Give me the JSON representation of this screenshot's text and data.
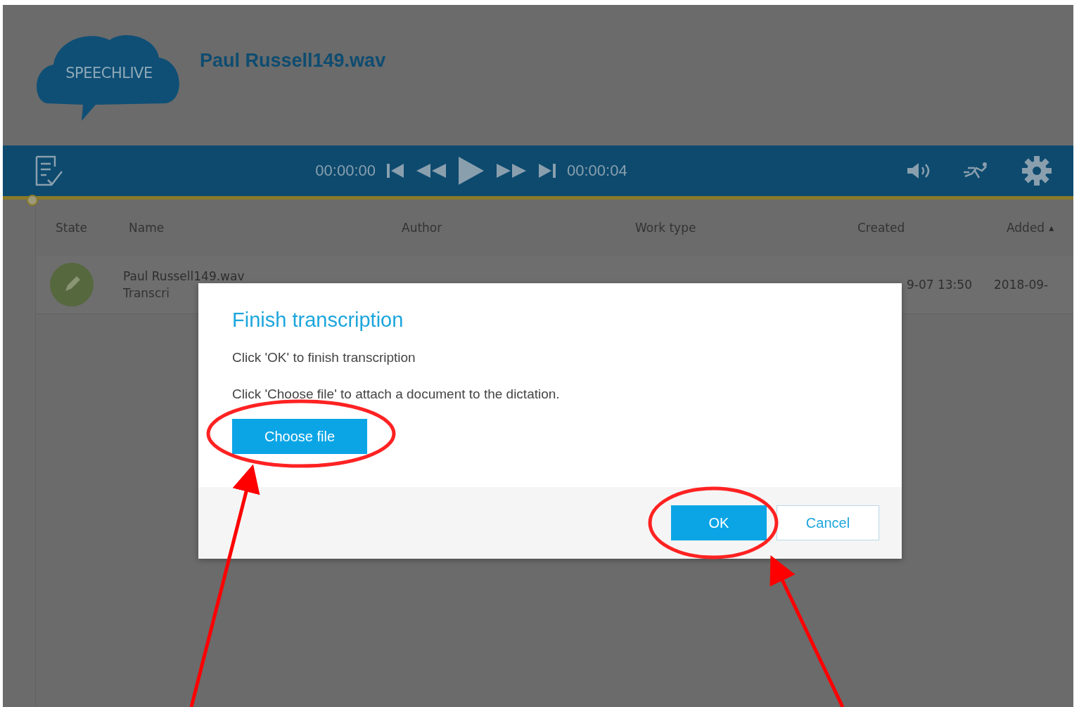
{
  "header": {
    "logo_text": "SPEECHLIVE",
    "file_title": "Paul Russell149.wav"
  },
  "player": {
    "time_elapsed": "00:00:00",
    "time_total": "00:00:04",
    "level": 0
  },
  "table": {
    "columns": [
      {
        "label": "State"
      },
      {
        "label": "Name"
      },
      {
        "label": "Author"
      },
      {
        "label": "Work type"
      },
      {
        "label": "Created"
      },
      {
        "label": "Added",
        "sort_mark": "▴"
      }
    ],
    "rows": [
      {
        "name": "Paul Russell149.wav",
        "status": "Transcri",
        "created": "9-07 13:50",
        "added": "2018-09-"
      }
    ]
  },
  "dialog": {
    "title": "Finish transcription",
    "lines": [
      "Click 'OK' to finish transcription",
      "Click 'Choose file' to attach a document to the dictation."
    ],
    "choose_button": "Choose file",
    "ok_button": "OK",
    "cancel_button": "Cancel"
  }
}
